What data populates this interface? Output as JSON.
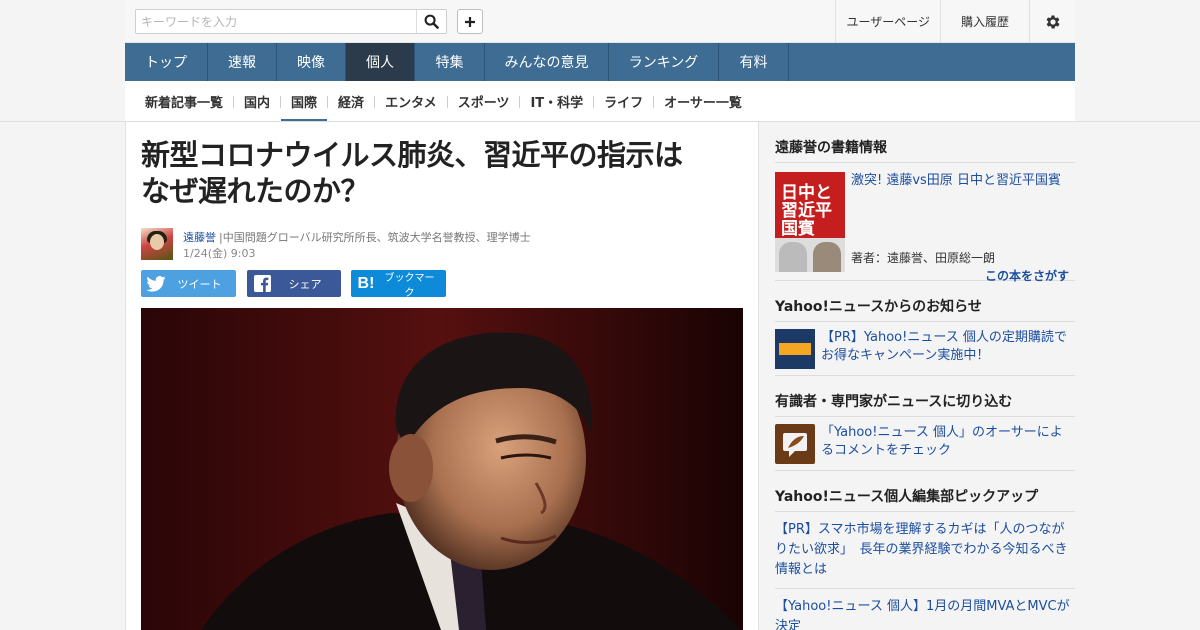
{
  "topbar": {
    "search_placeholder": "キーワードを入力",
    "links": [
      "ユーザーページ",
      "購入履歴"
    ]
  },
  "main_nav": {
    "items": [
      "トップ",
      "速報",
      "映像",
      "個人",
      "特集",
      "みんなの意見",
      "ランキング",
      "有料"
    ],
    "active": "個人"
  },
  "sub_nav": {
    "items": [
      "新着記事一覧",
      "国内",
      "国際",
      "経済",
      "エンタメ",
      "スポーツ",
      "IT・科学",
      "ライフ",
      "オーサー一覧"
    ],
    "active": "国際"
  },
  "article": {
    "title_line1": "新型コロナウイルス肺炎、習近平の指示は",
    "title_line2": "なぜ遅れたのか？",
    "author": "遠藤誉",
    "author_desc": "|中国問題グローバル研究所所長、筑波大学名誉教授、理学博士",
    "date": "1/24(金) 9:03",
    "share": {
      "tweet": "ツイート",
      "facebook": "シェア",
      "hatena": "ブックマーク"
    }
  },
  "sidebar": {
    "book_section": {
      "heading": "遠藤誉の書籍情報",
      "cover_text": "日中と習近平国賓",
      "title": "激突! 遠藤vs田原 日中と習近平国賓",
      "authors": "著者：遠藤誉、田原総一朗",
      "find": "この本をさがす"
    },
    "notice_section": {
      "heading": "Yahoo!ニュースからのお知らせ",
      "text": "【PR】Yahoo!ニュース 個人の定期購読でお得なキャンペーン実施中！"
    },
    "expert_section": {
      "heading": "有識者・専門家がニュースに切り込む",
      "text": "「Yahoo!ニュース 個人」のオーサーによるコメントをチェック"
    },
    "pickup_section": {
      "heading": "Yahoo!ニュース個人編集部ピックアップ",
      "items": [
        "【PR】スマホ市場を理解するカギは「人のつながりたい欲求」　長年の業界経験でわかる今知るべき情報とは",
        "【Yahoo!ニュース 個人】1月の月間MVAとMVCが決定"
      ]
    }
  },
  "colors": {
    "nav_blue": "#3e6c93",
    "nav_active": "#2b3b4b",
    "link_blue": "#1c4ea0",
    "twitter": "#4ea1e0",
    "facebook": "#3b5998",
    "hatena": "#0d8bd9"
  }
}
